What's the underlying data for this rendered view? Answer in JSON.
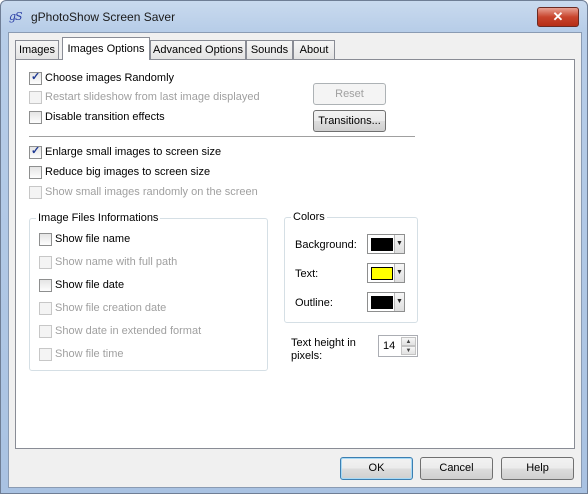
{
  "window": {
    "title": "gPhotoShow Screen Saver",
    "icon_glyph": "gS",
    "close_glyph": "✕"
  },
  "tabs": [
    {
      "label": "Images",
      "active": false
    },
    {
      "label": "Images Options",
      "active": true
    },
    {
      "label": "Advanced Options",
      "active": false
    },
    {
      "label": "Sounds",
      "active": false
    },
    {
      "label": "About",
      "active": false
    }
  ],
  "options": {
    "choose_random": {
      "label": "Choose images Randomly",
      "checked": true,
      "enabled": true
    },
    "restart_last": {
      "label": "Restart slideshow from last image displayed",
      "checked": false,
      "enabled": false
    },
    "disable_transition": {
      "label": "Disable transition effects",
      "checked": false,
      "enabled": true
    },
    "enlarge_small": {
      "label": "Enlarge small images to screen size",
      "checked": true,
      "enabled": true
    },
    "reduce_big": {
      "label": "Reduce big images to screen size",
      "checked": false,
      "enabled": true
    },
    "show_small_random": {
      "label": "Show small images randomly on the screen",
      "checked": false,
      "enabled": false
    }
  },
  "buttons": {
    "reset": "Reset",
    "transitions": "Transitions...",
    "ok": "OK",
    "cancel": "Cancel",
    "help": "Help"
  },
  "file_info": {
    "title": "Image Files Informations",
    "items": [
      {
        "label": "Show file name",
        "checked": false,
        "enabled": true
      },
      {
        "label": "Show name with full path",
        "checked": false,
        "enabled": false
      },
      {
        "label": "Show file date",
        "checked": false,
        "enabled": true
      },
      {
        "label": "Show file creation date",
        "checked": false,
        "enabled": false
      },
      {
        "label": "Show date in extended format",
        "checked": false,
        "enabled": false
      },
      {
        "label": "Show file time",
        "checked": false,
        "enabled": false
      }
    ]
  },
  "colors": {
    "title": "Colors",
    "background": {
      "label": "Background:",
      "value": "#000000"
    },
    "text": {
      "label": "Text:",
      "value": "#ffff00"
    },
    "outline": {
      "label": "Outline:",
      "value": "#000000"
    }
  },
  "text_height": {
    "label_line1": "Text height in",
    "label_line2": "pixels:",
    "value": "14"
  }
}
